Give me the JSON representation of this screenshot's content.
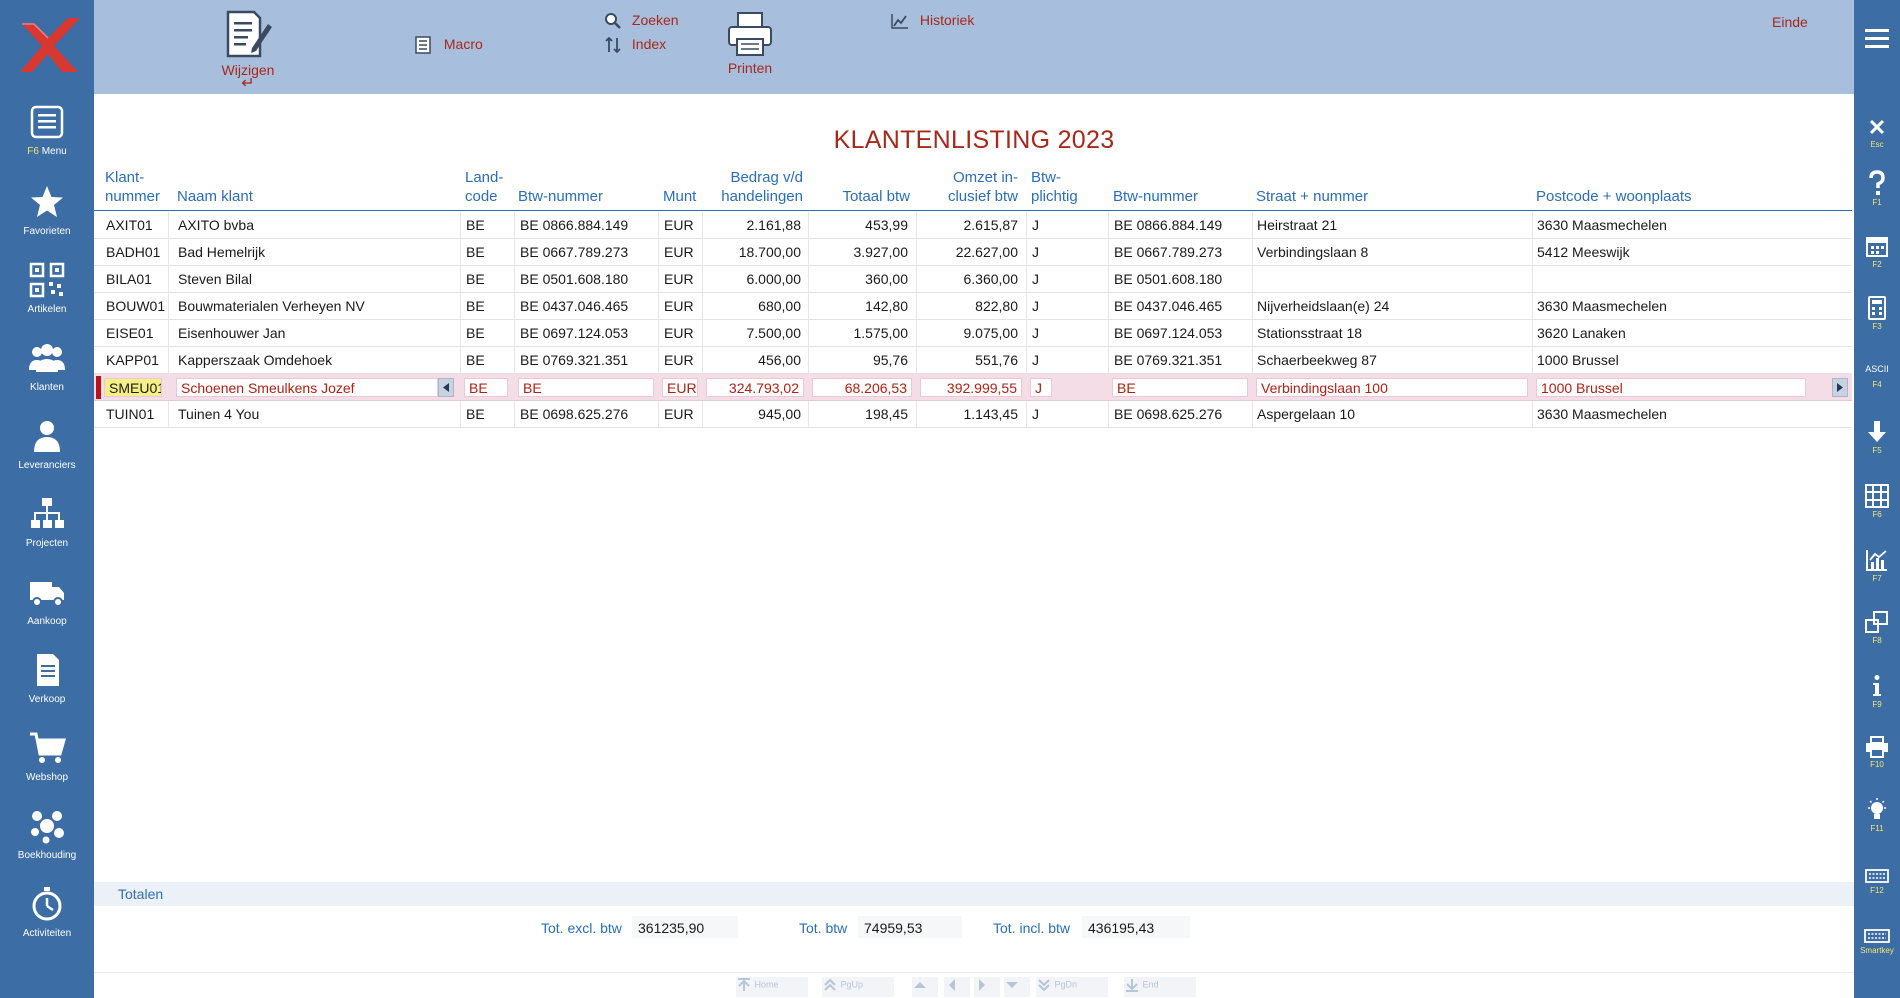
{
  "sidebar": {
    "items": [
      {
        "fkey": "F6",
        "label": "Menu"
      },
      {
        "label": "Favorieten"
      },
      {
        "label": "Artikelen"
      },
      {
        "label": "Klanten"
      },
      {
        "label": "Leveranciers"
      },
      {
        "label": "Projecten"
      },
      {
        "label": "Aankoop"
      },
      {
        "label": "Verkoop"
      },
      {
        "label": "Webshop"
      },
      {
        "label": "Boekhouding"
      },
      {
        "label": "Activiteiten"
      }
    ]
  },
  "toolbar": {
    "wijzigen": "Wijzigen",
    "macro": "Macro",
    "zoeken": "Zoeken",
    "index": "Index",
    "printen": "Printen",
    "historiek": "Historiek",
    "einde": "Einde"
  },
  "right_sidebar": {
    "items": [
      {
        "icon": "close-icon",
        "label": "Esc"
      },
      {
        "icon": "help-icon",
        "label": "F1"
      },
      {
        "icon": "calendar-icon",
        "label": "F2"
      },
      {
        "icon": "calculator-icon",
        "label": "F3"
      },
      {
        "icon": "ascii-icon",
        "label": "F4",
        "text": "ASCII"
      },
      {
        "icon": "download-icon",
        "label": "F5"
      },
      {
        "icon": "grid-icon",
        "label": "F6"
      },
      {
        "icon": "chart-icon",
        "label": "F7"
      },
      {
        "icon": "windows-icon",
        "label": "F8"
      },
      {
        "icon": "info-icon",
        "label": "F9"
      },
      {
        "icon": "printer-icon",
        "label": "F10"
      },
      {
        "icon": "lightbulb-icon",
        "label": "F11"
      },
      {
        "icon": "keyboard-icon",
        "label": "F12"
      },
      {
        "icon": "keyboard-icon",
        "label": "Smartkey"
      }
    ]
  },
  "report": {
    "title": "KLANTENLISTING 2023",
    "columns": {
      "klantnummer": [
        "Klant-",
        "nummer"
      ],
      "naam": "Naam klant",
      "landcode": [
        "Land-",
        "code"
      ],
      "btwnummer": "Btw-nummer",
      "munt": "Munt",
      "bedrag": [
        "Bedrag v/d",
        "handelingen"
      ],
      "totaal_btw": "Totaal btw",
      "omzet": [
        "Omzet in-",
        "clusief btw"
      ],
      "btwplichtig": [
        "Btw-",
        "plichtig"
      ],
      "btwnummer2": "Btw-nummer",
      "straat": "Straat + nummer",
      "postcode": "Postcode + woonplaats"
    },
    "rows": [
      {
        "klant": "AXIT01",
        "naam": "AXITO bvba",
        "land": "BE",
        "btw": "BE 0866.884.149",
        "munt": "EUR",
        "bedrag": "2.161,88",
        "totbtw": "453,99",
        "omzet": "2.615,87",
        "plichtig": "J",
        "btw2": "BE 0866.884.149",
        "straat": "Heirstraat 21",
        "postcode": "3630 Maasmechelen"
      },
      {
        "klant": "BADH01",
        "naam": "Bad Hemelrijk",
        "land": "BE",
        "btw": "BE 0667.789.273",
        "munt": "EUR",
        "bedrag": "18.700,00",
        "totbtw": "3.927,00",
        "omzet": "22.627,00",
        "plichtig": "J",
        "btw2": "BE 0667.789.273",
        "straat": "Verbindingslaan 8",
        "postcode": "5412 Meeswijk"
      },
      {
        "klant": "BILA01",
        "naam": "Steven Bilal",
        "land": "BE",
        "btw": "BE 0501.608.180",
        "munt": "EUR",
        "bedrag": "6.000,00",
        "totbtw": "360,00",
        "omzet": "6.360,00",
        "plichtig": "J",
        "btw2": "BE 0501.608.180",
        "straat": "",
        "postcode": ""
      },
      {
        "klant": "BOUW01",
        "naam": "Bouwmaterialen Verheyen NV",
        "land": "BE",
        "btw": "BE 0437.046.465",
        "munt": "EUR",
        "bedrag": "680,00",
        "totbtw": "142,80",
        "omzet": "822,80",
        "plichtig": "J",
        "btw2": "BE 0437.046.465",
        "straat": "Nijverheidslaan(e) 24",
        "postcode": "3630 Maasmechelen"
      },
      {
        "klant": "EISE01",
        "naam": "Eisenhouwer Jan",
        "land": "BE",
        "btw": "BE 0697.124.053",
        "munt": "EUR",
        "bedrag": "7.500,00",
        "totbtw": "1.575,00",
        "omzet": "9.075,00",
        "plichtig": "J",
        "btw2": "BE 0697.124.053",
        "straat": "Stationsstraat 18",
        "postcode": "3620 Lanaken"
      },
      {
        "klant": "KAPP01",
        "naam": "Kapperszaak Omdehoek",
        "land": "BE",
        "btw": "BE 0769.321.351",
        "munt": "EUR",
        "bedrag": "456,00",
        "totbtw": "95,76",
        "omzet": "551,76",
        "plichtig": "J",
        "btw2": "BE 0769.321.351",
        "straat": "Schaerbeekweg 87",
        "postcode": "1000 Brussel"
      },
      {
        "klant": "SMEU01",
        "naam": "Schoenen Smeulkens Jozef",
        "land": "BE",
        "btw": "BE",
        "munt": "EUR",
        "bedrag": "324.793,02",
        "totbtw": "68.206,53",
        "omzet": "392.999,55",
        "plichtig": "J",
        "btw2": "BE",
        "straat": "Verbindingslaan 100",
        "postcode": "1000 Brussel"
      },
      {
        "klant": "TUIN01",
        "naam": "Tuinen 4 You",
        "land": "BE",
        "btw": "BE 0698.625.276",
        "munt": "EUR",
        "bedrag": "945,00",
        "totbtw": "198,45",
        "omzet": "1.143,45",
        "plichtig": "J",
        "btw2": "BE 0698.625.276",
        "straat": "Aspergelaan 10",
        "postcode": "3630 Maasmechelen"
      }
    ]
  },
  "totals": {
    "title": "Totalen",
    "excl_label": "Tot. excl. btw",
    "excl_value": "361235,90",
    "btw_label": "Tot. btw",
    "btw_value": "74959,53",
    "incl_label": "Tot. incl. btw",
    "incl_value": "436195,43"
  },
  "nav": {
    "home": "Home",
    "pgup": "PgUp",
    "pgdn": "PgDn",
    "end": "End"
  }
}
